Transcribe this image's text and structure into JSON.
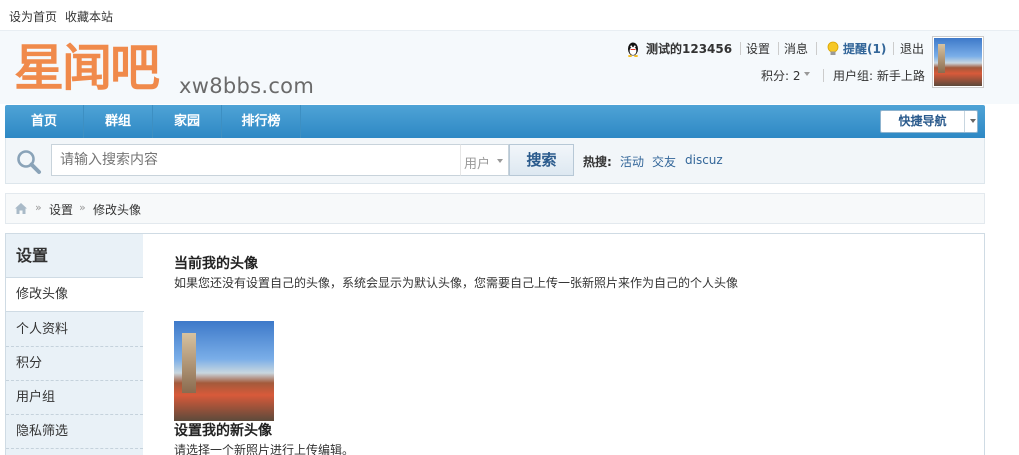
{
  "topbar": {
    "set_home": "设为首页",
    "bookmark": "收藏本站"
  },
  "logo": {
    "cn_text": "星闻吧",
    "en_text": "xw8bbs.com"
  },
  "user": {
    "name": "测试的123456",
    "settings": "设置",
    "messages": "消息",
    "reminders": "提醒(1)",
    "logout": "退出",
    "points_label": "积分: 2",
    "group_label": "用户组: 新手上路"
  },
  "nav": {
    "items": [
      "首页",
      "群组",
      "家园",
      "排行榜"
    ],
    "quick_nav": "快捷导航"
  },
  "search": {
    "placeholder": "请输入搜索内容",
    "type": "用户",
    "button": "搜索",
    "hot_label": "热搜:",
    "hot_terms": [
      "活动",
      "交友",
      "discuz"
    ]
  },
  "breadcrumb": {
    "items": [
      "设置",
      "修改头像"
    ]
  },
  "sidebar": {
    "title": "设置",
    "items": [
      "修改头像",
      "个人资料",
      "积分",
      "用户组",
      "隐私筛选"
    ]
  },
  "content": {
    "current_title": "当前我的头像",
    "current_desc": "如果您还没有设置自己的头像，系统会显示为默认头像，您需要自己上传一张新照片来作为自己的个人头像",
    "new_title": "设置我的新头像",
    "new_desc": "请选择一个新照片进行上传编辑。"
  },
  "colors": {
    "nav_blue": "#3a94cc",
    "logo_orange": "#f08a4b",
    "link_blue": "#336699"
  }
}
